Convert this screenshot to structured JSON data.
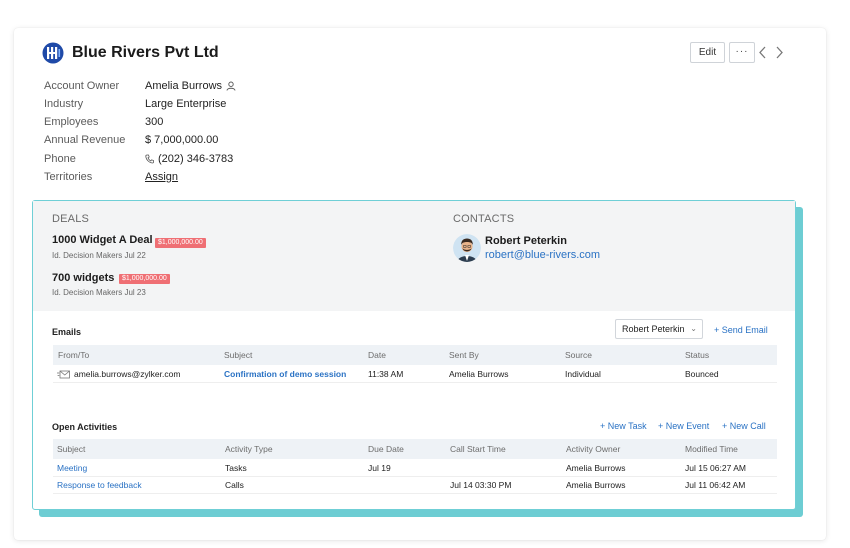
{
  "account": {
    "name": "Blue Rivers Pvt Ltd"
  },
  "toolbar": {
    "edit_label": "Edit",
    "more_label": "···"
  },
  "details": [
    {
      "label": "Account Owner",
      "value": "Amelia Burrows",
      "icon": "user-icon"
    },
    {
      "label": "Industry",
      "value": "Large Enterprise"
    },
    {
      "label": "Employees",
      "value": "300"
    },
    {
      "label": "Annual Revenue",
      "value": "$ 7,000,000.00"
    },
    {
      "label": "Phone",
      "value": "(202) 346-3783",
      "icon": "phone-icon"
    },
    {
      "label": "Territories",
      "value": "Assign"
    }
  ],
  "deals": {
    "label": "DEALS",
    "items": [
      {
        "name": "1000 Widget A Deal",
        "amount": "$1,000,000.00",
        "sub": "Id. Decision Makers Jul 22"
      },
      {
        "name": "700 widgets",
        "amount": "$1,000,000.00",
        "sub": "Id. Decision Makers Jul 23"
      }
    ]
  },
  "contacts": {
    "label": "CONTACTS",
    "name": "Robert Peterkin",
    "email": "robert@blue-rivers.com"
  },
  "emails": {
    "title": "Emails",
    "owner_select": "Robert Peterkin",
    "send_label": "+ Send Email",
    "columns": [
      "From/To",
      "Subject",
      "Date",
      "Sent By",
      "Source",
      "Status"
    ],
    "rows": [
      {
        "from": "amelia.burrows@zylker.com",
        "subject": "Confirmation of demo session",
        "date": "11:38 AM",
        "sent_by": "Amelia Burrows",
        "source": "Individual",
        "status": "Bounced"
      }
    ]
  },
  "activities": {
    "title": "Open Activities",
    "new_task": "+ New Task",
    "new_event": "+ New Event",
    "new_call": "+ New Call",
    "columns": [
      "Subject",
      "Activity Type",
      "Due Date",
      "Call Start Time",
      "Activity Owner",
      "Modified Time"
    ],
    "rows": [
      {
        "subject": "Meeting",
        "type": "Tasks",
        "due": "Jul 19",
        "call_start": "",
        "owner": "Amelia Burrows",
        "modified": "Jul 15 06:27 AM"
      },
      {
        "subject": "Response to feedback",
        "type": "Calls",
        "due": "",
        "call_start": "Jul 14 03:30 PM",
        "owner": "Amelia Burrows",
        "modified": "Jul 11 06:42 AM"
      }
    ]
  },
  "colors": {
    "accent_teal": "#6dcdd3",
    "link_blue": "#2a72c4",
    "amount_badge": "#ef6f74"
  }
}
